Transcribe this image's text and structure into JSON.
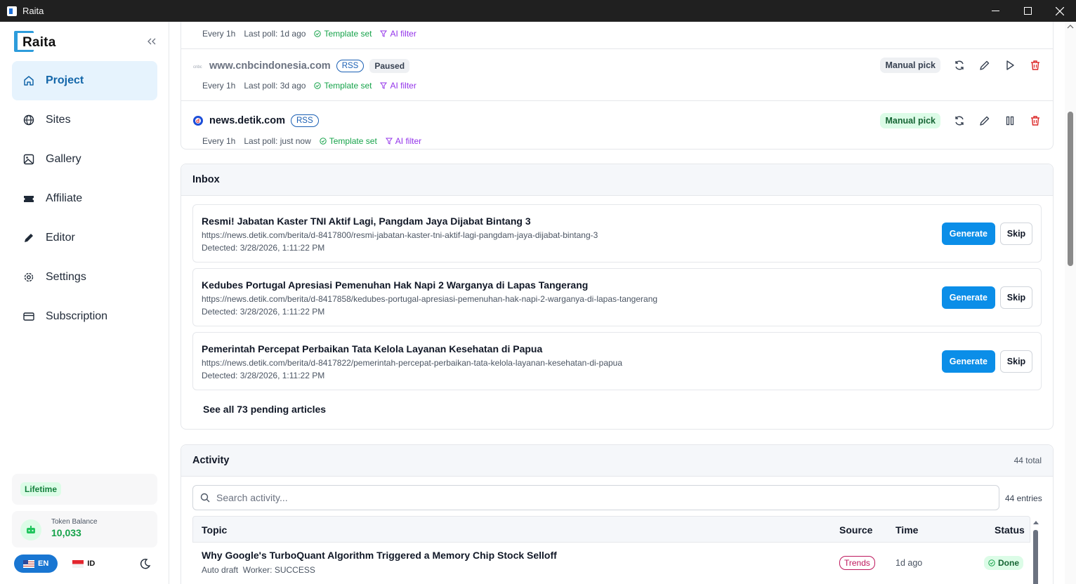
{
  "window": {
    "title": "Raita"
  },
  "sidebar": {
    "logo_text": "Raita",
    "items": [
      {
        "label": "Project",
        "icon": "home-icon",
        "active": true
      },
      {
        "label": "Sites",
        "icon": "globe-icon"
      },
      {
        "label": "Gallery",
        "icon": "image-icon"
      },
      {
        "label": "Affiliate",
        "icon": "ticket-icon"
      },
      {
        "label": "Editor",
        "icon": "pencil-icon"
      },
      {
        "label": "Settings",
        "icon": "gear-icon"
      },
      {
        "label": "Subscription",
        "icon": "card-icon"
      }
    ],
    "plan_badge": "Lifetime",
    "token_label": "Token Balance",
    "token_value": "10,033",
    "languages": [
      {
        "label": "EN",
        "active": true
      },
      {
        "label": "ID",
        "active": false
      }
    ]
  },
  "sites": [
    {
      "name": "",
      "rss": "",
      "status": "",
      "interval": "Every 1h",
      "last_poll": "Last poll: 1d ago",
      "template": "Template set",
      "filter": "AI filter"
    },
    {
      "name": "www.cnbcindonesia.com",
      "rss": "RSS",
      "status": "Paused",
      "interval": "Every 1h",
      "last_poll": "Last poll: 3d ago",
      "template": "Template set",
      "filter": "AI filter",
      "pick": "Manual pick"
    },
    {
      "name": "news.detik.com",
      "rss": "RSS",
      "status": "",
      "interval": "Every 1h",
      "last_poll": "Last poll: just now",
      "template": "Template set",
      "filter": "AI filter",
      "pick": "Manual pick"
    }
  ],
  "inbox": {
    "title": "Inbox",
    "generate_label": "Generate",
    "skip_label": "Skip",
    "items": [
      {
        "title": "Resmi! Jabatan Kaster TNI Aktif Lagi, Pangdam Jaya Dijabat Bintang 3",
        "url": "https://news.detik.com/berita/d-8417800/resmi-jabatan-kaster-tni-aktif-lagi-pangdam-jaya-dijabat-bintang-3",
        "detected": "Detected: 3/28/2026, 1:11:22 PM"
      },
      {
        "title": "Kedubes Portugal Apresiasi Pemenuhan Hak Napi 2 Warganya di Lapas Tangerang",
        "url": "https://news.detik.com/berita/d-8417858/kedubes-portugal-apresiasi-pemenuhan-hak-napi-2-warganya-di-lapas-tangerang",
        "detected": "Detected: 3/28/2026, 1:11:22 PM"
      },
      {
        "title": "Pemerintah Percepat Perbaikan Tata Kelola Layanan Kesehatan di Papua",
        "url": "https://news.detik.com/berita/d-8417822/pemerintah-percepat-perbaikan-tata-kelola-layanan-kesehatan-di-papua",
        "detected": "Detected: 3/28/2026, 1:11:22 PM"
      }
    ],
    "see_all": "See all 73 pending articles"
  },
  "activity": {
    "title": "Activity",
    "total": "44 total",
    "search_placeholder": "Search activity...",
    "entries": "44 entries",
    "columns": {
      "topic": "Topic",
      "source": "Source",
      "time": "Time",
      "status": "Status"
    },
    "rows": [
      {
        "topic": "Why Google's TurboQuant Algorithm Triggered a Memory Chip Stock Selloff",
        "type": "Auto draft",
        "worker": "Worker: SUCCESS",
        "source": "Trends",
        "time": "1d ago",
        "status": "Done"
      }
    ]
  },
  "colors": {
    "accent": "#0b8ee8",
    "active_nav_bg": "#e6f3fd",
    "success": "#16a34a",
    "purple": "#9333ea",
    "danger": "#dc2626"
  }
}
